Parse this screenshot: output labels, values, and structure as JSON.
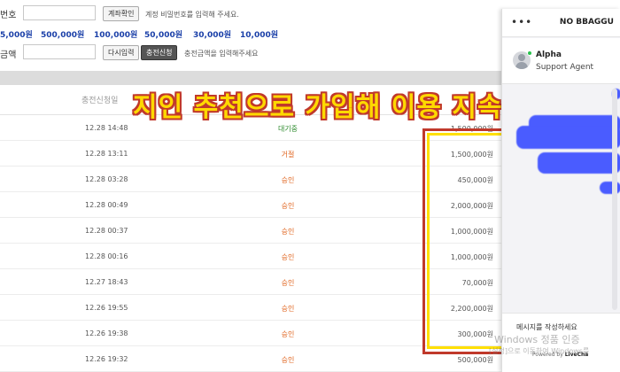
{
  "form": {
    "account_label": "번호",
    "account_button": "계좌확인",
    "account_hint": "계정 비밀번호를 입력해 주세요.",
    "amounts": [
      "5,000원",
      "500,000원",
      "100,000원",
      "50,000원",
      "30,000원",
      "10,000원"
    ],
    "amount_label": "금액",
    "reset_button": "다시입력",
    "submit_button": "충전신청",
    "amount_hint": "충전금액을 입력해주세요"
  },
  "table": {
    "date_header": "충전신청일",
    "rows": [
      {
        "date": "12.28 14:48",
        "status": "대기중",
        "amount": "1,500,000원",
        "status_color": "#2e8b2e"
      },
      {
        "date": "12.28 13:11",
        "status": "거절",
        "amount": "1,500,000원",
        "status_color": "#e0651f"
      },
      {
        "date": "12.28 03:28",
        "status": "승인",
        "amount": "450,000원",
        "status_color": "#e0651f"
      },
      {
        "date": "12.28 00:49",
        "status": "승인",
        "amount": "2,000,000원",
        "status_color": "#e0651f"
      },
      {
        "date": "12.28 00:37",
        "status": "승인",
        "amount": "1,000,000원",
        "status_color": "#e0651f"
      },
      {
        "date": "12.28 00:16",
        "status": "승인",
        "amount": "1,000,000원",
        "status_color": "#e0651f"
      },
      {
        "date": "12.27 18:43",
        "status": "승인",
        "amount": "70,000원",
        "status_color": "#e0651f"
      },
      {
        "date": "12.26 19:55",
        "status": "승인",
        "amount": "2,200,000원",
        "status_color": "#e0651f"
      },
      {
        "date": "12.26 19:38",
        "status": "승인",
        "amount": "300,000원",
        "status_color": "#e0651f"
      },
      {
        "date": "12.26 19:32",
        "status": "승인",
        "amount": "500,000원",
        "status_color": "#e0651f"
      }
    ]
  },
  "banner": "지인 추천으로 가입해 이용 지속",
  "chat": {
    "brand": "NO BBAGGU",
    "menu_icon": "more-dots-icon",
    "agent_name": "Alpha",
    "agent_role": "Support Agent",
    "input_placeholder": "메시지를 작성하세요",
    "powered_by_prefix": "Powered by",
    "powered_by_brand": "LiveCha"
  },
  "watermark": {
    "line1": "Windows 정품 인증",
    "line2": "[설정]으로 이동하여 Windows를"
  }
}
